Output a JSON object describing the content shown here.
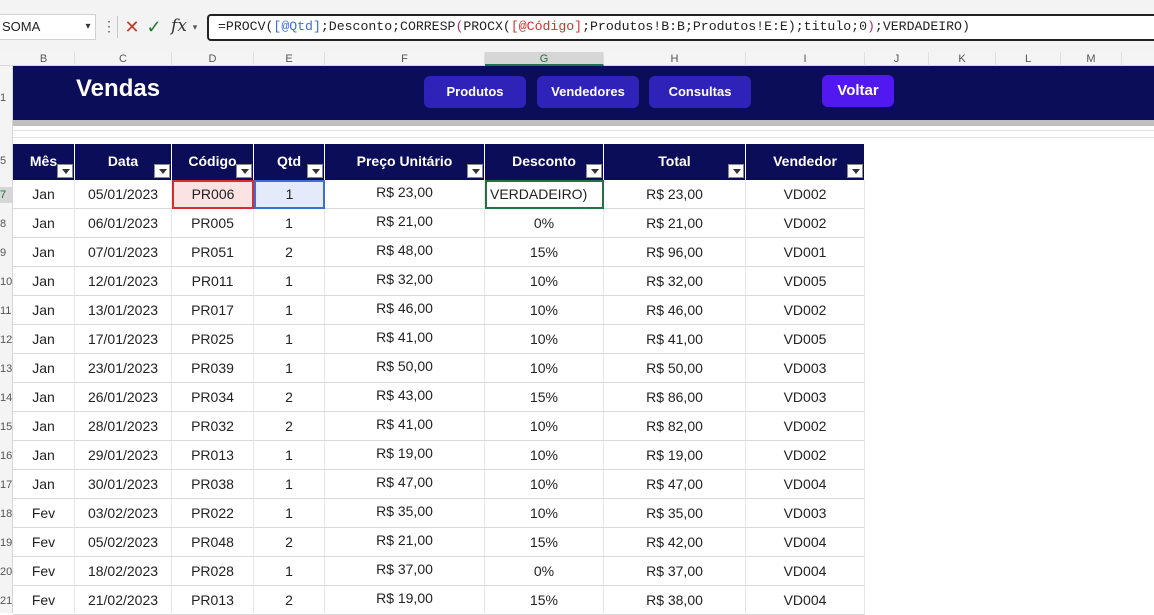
{
  "formula_bar": {
    "name_box": "SOMA",
    "cancel_symbol": "✕",
    "enter_symbol": "✓",
    "fx_label": "fx",
    "formula_parts": [
      {
        "t": "=PROCV(",
        "c": ""
      },
      {
        "t": "[@Qtd]",
        "c": "ref-blue"
      },
      {
        "t": ";Desconto;CORRESP",
        "c": ""
      },
      {
        "t": "(",
        "c": "paren"
      },
      {
        "t": "PROCX(",
        "c": ""
      },
      {
        "t": "[@Código]",
        "c": "ref-red"
      },
      {
        "t": ";Produtos!B:B;Produtos!E:E",
        "c": ""
      },
      {
        "t": ")",
        "c": ""
      },
      {
        "t": ";titulo;0",
        "c": ""
      },
      {
        "t": ")",
        "c": "paren"
      },
      {
        "t": ";VERDADEIRO)",
        "c": ""
      }
    ]
  },
  "columns": [
    "B",
    "C",
    "D",
    "E",
    "F",
    "G",
    "H",
    "I",
    "J",
    "K",
    "L",
    "M"
  ],
  "selected_column": "G",
  "row_numbers": [
    "1",
    "5",
    "7",
    "8",
    "9",
    "10",
    "11",
    "12",
    "13",
    "14",
    "15",
    "16",
    "17",
    "18",
    "19",
    "20",
    "21"
  ],
  "selected_row": "7",
  "banner": {
    "title": "Vendas",
    "buttons": [
      "Produtos",
      "Vendedores",
      "Consultas",
      "Voltar"
    ]
  },
  "table": {
    "headers": [
      "Mês",
      "Data",
      "Código",
      "Qtd",
      "Preço Unitário",
      "Desconto",
      "Total",
      "Vendedor"
    ],
    "rows": [
      [
        "Jan",
        "05/01/2023",
        "PR006",
        "1",
        "R$ 23,00",
        "VERDADEIRO)",
        "R$ 23,00",
        "VD002"
      ],
      [
        "Jan",
        "06/01/2023",
        "PR005",
        "1",
        "R$ 21,00",
        "0%",
        "R$ 21,00",
        "VD002"
      ],
      [
        "Jan",
        "07/01/2023",
        "PR051",
        "2",
        "R$ 48,00",
        "15%",
        "R$ 96,00",
        "VD001"
      ],
      [
        "Jan",
        "12/01/2023",
        "PR011",
        "1",
        "R$ 32,00",
        "10%",
        "R$ 32,00",
        "VD005"
      ],
      [
        "Jan",
        "13/01/2023",
        "PR017",
        "1",
        "R$ 46,00",
        "10%",
        "R$ 46,00",
        "VD002"
      ],
      [
        "Jan",
        "17/01/2023",
        "PR025",
        "1",
        "R$ 41,00",
        "10%",
        "R$ 41,00",
        "VD005"
      ],
      [
        "Jan",
        "23/01/2023",
        "PR039",
        "1",
        "R$ 50,00",
        "10%",
        "R$ 50,00",
        "VD003"
      ],
      [
        "Jan",
        "26/01/2023",
        "PR034",
        "2",
        "R$ 43,00",
        "15%",
        "R$ 86,00",
        "VD003"
      ],
      [
        "Jan",
        "28/01/2023",
        "PR032",
        "2",
        "R$ 41,00",
        "10%",
        "R$ 82,00",
        "VD002"
      ],
      [
        "Jan",
        "29/01/2023",
        "PR013",
        "1",
        "R$ 19,00",
        "10%",
        "R$ 19,00",
        "VD002"
      ],
      [
        "Jan",
        "30/01/2023",
        "PR038",
        "1",
        "R$ 47,00",
        "10%",
        "R$ 47,00",
        "VD004"
      ],
      [
        "Fev",
        "03/02/2023",
        "PR022",
        "1",
        "R$ 35,00",
        "10%",
        "R$ 35,00",
        "VD003"
      ],
      [
        "Fev",
        "05/02/2023",
        "PR048",
        "2",
        "R$ 21,00",
        "15%",
        "R$ 42,00",
        "VD004"
      ],
      [
        "Fev",
        "18/02/2023",
        "PR028",
        "1",
        "R$ 37,00",
        "0%",
        "R$ 37,00",
        "VD004"
      ],
      [
        "Fev",
        "21/02/2023",
        "PR013",
        "2",
        "R$ 19,00",
        "15%",
        "R$ 38,00",
        "VD004"
      ]
    ]
  },
  "colors": {
    "banner_bg": "#0b0d59",
    "nav_button": "#2f22b8",
    "voltar_button": "#5218f0",
    "active_cell_border": "#217346",
    "codigo_ref_highlight": "#d23030",
    "qtd_ref_highlight": "#3a6fd8"
  }
}
